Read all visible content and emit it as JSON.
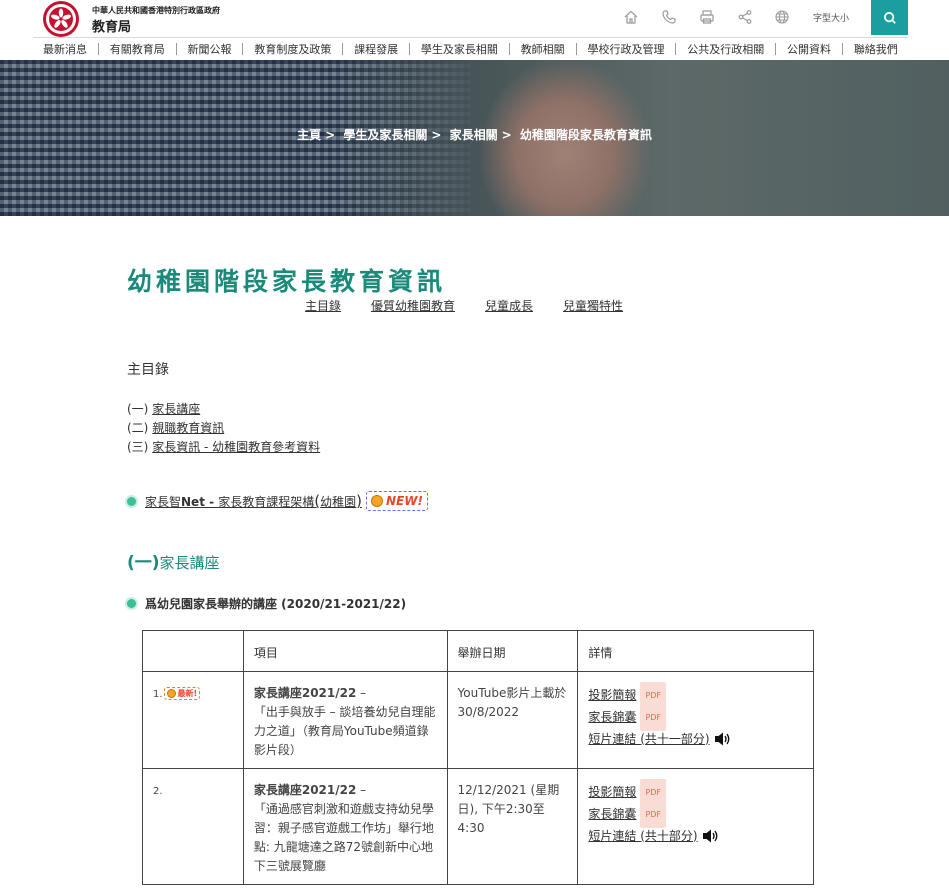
{
  "header": {
    "gov_line": "中華人民共和國香港特別行政區政府",
    "bureau": "教育局",
    "font_size_label": "字型大小",
    "tools": [
      "home-icon",
      "phone-icon",
      "print-icon",
      "share-icon",
      "globe-icon"
    ],
    "accent_color": "#1c9e9e"
  },
  "nav": [
    "最新消息",
    "有關教育局",
    "新聞公報",
    "教育制度及政策",
    "課程發展",
    "學生及家長相關",
    "教師相關",
    "學校行政及管理",
    "公共及行政相關",
    "公開資料",
    "聯絡我們"
  ],
  "breadcrumb": {
    "items": [
      "主頁",
      "學生及家長相關",
      "家長相關"
    ],
    "current": "幼稚園階段家長教育資訊",
    "sep": ">"
  },
  "page": {
    "title": "幼稚園階段家長教育資訊",
    "title_color": "#1a8a7a",
    "subnav": [
      "主目錄",
      "優質幼稚園教育",
      "兒童成長",
      "兒童獨特性"
    ],
    "toc_heading": "主目錄",
    "toc": [
      {
        "prefix": "(一)",
        "label": "家長講座"
      },
      {
        "prefix": "(二)",
        "label": "親職教育資訊"
      },
      {
        "prefix": "(三)",
        "label": "家長資訊 - 幼稚園教育參考資料"
      }
    ],
    "featured": {
      "pre": "家長智",
      "bold": "Net - ",
      "rest": "家長教育課程架構",
      "paren_open": "(",
      "paren_inner": "幼稚園",
      "paren_close": ")",
      "new_badge": "NEW!"
    },
    "section_prefix": "(一)",
    "section_title": "家長講座",
    "subsection": "爲幼兒園家長舉辦的講座 (2020/21-2021/22)"
  },
  "table": {
    "headers": [
      "",
      "項目",
      "舉辦日期",
      "詳情"
    ],
    "rows": [
      {
        "num": "1.",
        "badge": "最新!",
        "item_bold": "家長講座2021/22",
        "item_dash": " –",
        "item_text": "「出手與放手 – 談培養幼兒自理能力之道」（教育局YouTube頻道錄影片段）",
        "date": "YouTube影片上載於30/8/2022",
        "details": [
          {
            "label": "投影簡報",
            "pdf": "PDF"
          },
          {
            "label": "家長錦囊",
            "pdf": "PDF"
          },
          {
            "label": "短片連結 (共十一部分)",
            "audio": true
          }
        ]
      },
      {
        "num": "2.",
        "badge": "",
        "item_bold": "家長講座2021/22",
        "item_dash": " –",
        "item_text": "「通過感官刺激和遊戲支持幼兒學習：親子感官遊戲工作坊」舉行地點: 九龍塘達之路72號創新中心地下三號展覽廳",
        "date": "12/12/2021 (星期日), 下午2:30至4:30",
        "details": [
          {
            "label": "投影簡報",
            "pdf": "PDF"
          },
          {
            "label": "家長錦囊",
            "pdf": "PDF"
          },
          {
            "label": "短片連結 (共十部分)",
            "audio": true
          }
        ]
      }
    ]
  }
}
